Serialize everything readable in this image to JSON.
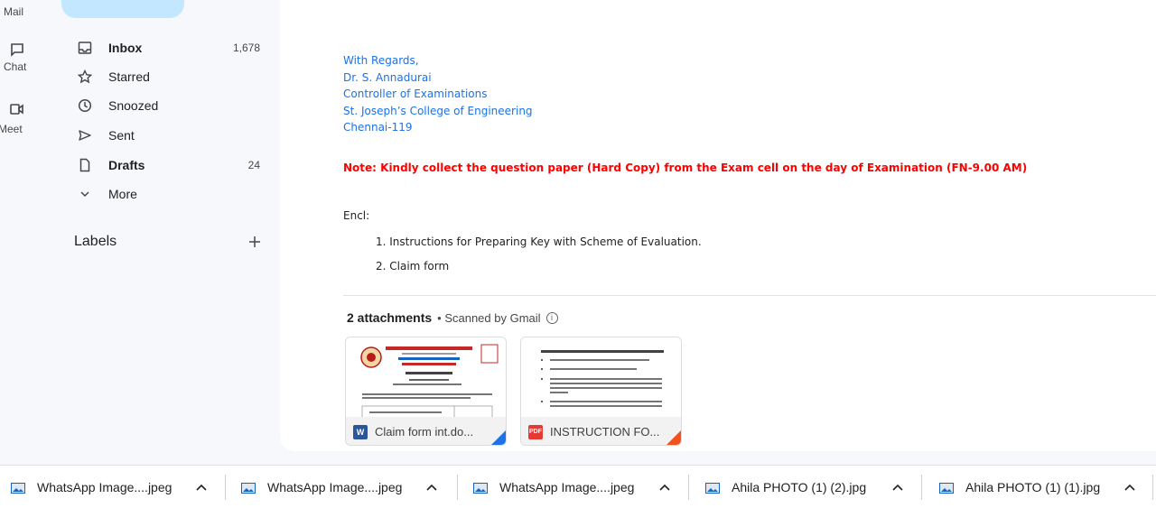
{
  "rail": {
    "items": [
      {
        "label": "Mail",
        "icon": "mail-icon"
      },
      {
        "label": "Chat",
        "icon": "chat-icon"
      },
      {
        "label": "Meet",
        "icon": "meet-icon"
      }
    ]
  },
  "nav": {
    "items": [
      {
        "label": "Inbox",
        "count": "1,678",
        "icon": "inbox-icon"
      },
      {
        "label": "Starred",
        "count": "",
        "icon": "star-icon"
      },
      {
        "label": "Snoozed",
        "count": "",
        "icon": "clock-icon"
      },
      {
        "label": "Sent",
        "count": "",
        "icon": "send-icon"
      },
      {
        "label": "Drafts",
        "count": "24",
        "icon": "draft-icon"
      },
      {
        "label": "More",
        "count": "",
        "icon": "chevron-down-icon"
      }
    ],
    "labels_header": "Labels"
  },
  "message": {
    "signature": [
      "With Regards,",
      "Dr. S. Annadurai",
      "Controller of Examinations",
      "St. Joseph’s College of Engineering",
      "Chennai-119"
    ],
    "note": "Note: Kindly collect the question paper (Hard Copy) from the Exam cell on the day of Examination (FN-9.00 AM)",
    "encl_label": "Encl:",
    "encl_items": [
      "1. Instructions for Preparing Key with Scheme of Evaluation.",
      "2. Claim form"
    ]
  },
  "attachments": {
    "count_label": "2 attachments",
    "scanned_label": "• Scanned by Gmail",
    "items": [
      {
        "name": "Claim form int.do...",
        "type_icon": "word-icon",
        "type_text": "W",
        "color": "#2b579a",
        "corner_color": "#1a73e8"
      },
      {
        "name": "INSTRUCTION FO...",
        "type_icon": "pdf-icon",
        "type_text": "PDF",
        "color": "#e53935",
        "corner_color": "#f4511e"
      }
    ]
  },
  "downloads": [
    {
      "name": "WhatsApp Image....jpeg"
    },
    {
      "name": "WhatsApp Image....jpeg"
    },
    {
      "name": "WhatsApp Image....jpeg"
    },
    {
      "name": "Ahila PHOTO (1) (2).jpg"
    },
    {
      "name": "Ahila PHOTO (1) (1).jpg"
    }
  ],
  "colors": {
    "signature": "#1a73e8",
    "note": "#ff0000",
    "compose": "#c2e7ff"
  }
}
